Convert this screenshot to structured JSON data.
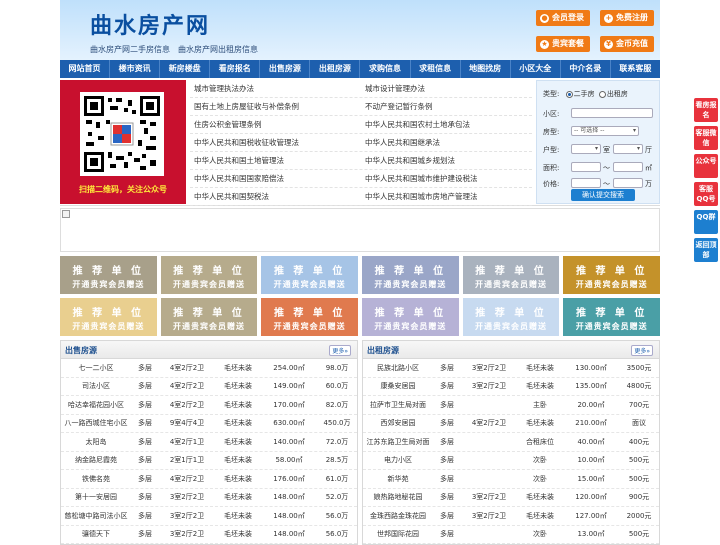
{
  "header": {
    "logo": "曲水房产网",
    "slogan": "曲水房产网二手房信息　曲水房产网出租房信息",
    "buttons": [
      {
        "label": "会员登录",
        "icon": "user-icon"
      },
      {
        "label": "免费注册",
        "icon": "user-add-icon"
      },
      {
        "label": "贵宾套餐",
        "icon": "vip-icon"
      },
      {
        "label": "金币充值",
        "icon": "coin-icon"
      }
    ]
  },
  "nav": [
    "网站首页",
    "楼市资讯",
    "新房楼盘",
    "看房报名",
    "出售房源",
    "出租房源",
    "求购信息",
    "求租信息",
    "地图找房",
    "小区大全",
    "中介名录",
    "联系客服"
  ],
  "qr": {
    "caption": "扫描二维码，关注公众号"
  },
  "laws": [
    [
      "城市管理执法办法",
      "城市设计管理办法"
    ],
    [
      "国有土地上房屋征收与补偿条例",
      "不动产登记暂行条例"
    ],
    [
      "住房公积金管理条例",
      "中华人民共和国农村土地承包法"
    ],
    [
      "中华人民共和国税收征收管理法",
      "中华人民共和国继承法"
    ],
    [
      "中华人民共和国土地管理法",
      "中华人民共和国城乡规划法"
    ],
    [
      "中华人民共和国国家赔偿法",
      "中华人民共和国城市维护建设税法"
    ],
    [
      "中华人民共和国契税法",
      "中华人民共和国城市房地产管理法"
    ]
  ],
  "search": {
    "type_label": "类型:",
    "type_options": [
      "二手房",
      "出租房"
    ],
    "community_label": "小区:",
    "house_label": "房型:",
    "house_select": "-- 可选择 --",
    "layout_label": "户型:",
    "room_unit": "室",
    "hall_unit": "厅",
    "area_label": "面积:",
    "area_unit": "㎡",
    "price_label": "价格:",
    "price_unit": "万",
    "range_sep": "～",
    "submit": "确认提交搜索"
  },
  "ads": {
    "line1": "推 荐 单 位",
    "line2": "开通贵宾会员赠送",
    "colors_row1": [
      "#a8a08a",
      "#b6ab8c",
      "#a6c4e6",
      "#9aa6c8",
      "#a9b2be",
      "#c4922a"
    ],
    "colors_row2": [
      "#e9cf8f",
      "#b6ab8c",
      "#e07a4e",
      "#b6b2d6",
      "#c7daf0",
      "#4a9fa6"
    ]
  },
  "sale": {
    "title": "出售房源",
    "more": "更多»",
    "rows": [
      [
        "七一二小区",
        "多层",
        "4室2厅2卫",
        "毛坯未装",
        "254.00㎡",
        "98.0万"
      ],
      [
        "司法小区",
        "多层",
        "4室2厅2卫",
        "毛坯未装",
        "149.00㎡",
        "60.0万"
      ],
      [
        "哈达幸福花园小区",
        "多层",
        "4室2厅2卫",
        "毛坯未装",
        "170.00㎡",
        "82.0万"
      ],
      [
        "八一路西城住宅小区",
        "多层",
        "9室4厅4卫",
        "毛坯未装",
        "630.00㎡",
        "450.0万"
      ],
      [
        "太阳岛",
        "多层",
        "4室2厅1卫",
        "毛坯未装",
        "140.00㎡",
        "72.0万"
      ],
      [
        "纳金路尼霞苑",
        "多层",
        "2室1厅1卫",
        "毛坯未装",
        "58.00㎡",
        "28.5万"
      ],
      [
        "铁佛名苑",
        "多层",
        "4室2厅2卫",
        "毛坯未装",
        "176.00㎡",
        "61.0万"
      ],
      [
        "第十一安居园",
        "多层",
        "3室2厅2卫",
        "毛坯未装",
        "148.00㎡",
        "52.0万"
      ],
      [
        "慈松塘中路司法小区",
        "多层",
        "3室2厅2卫",
        "毛坯未装",
        "148.00㎡",
        "56.0万"
      ],
      [
        "骧德天下",
        "多层",
        "3室2厅2卫",
        "毛坯未装",
        "148.00㎡",
        "56.0万"
      ]
    ]
  },
  "rent": {
    "title": "出租房源",
    "more": "更多»",
    "rows": [
      [
        "民族北路小区",
        "多层",
        "3室2厅2卫",
        "毛坯未装",
        "130.00㎡",
        "3500元"
      ],
      [
        "康桑安居园",
        "多层",
        "3室2厅2卫",
        "毛坯未装",
        "135.00㎡",
        "4800元"
      ],
      [
        "拉萨市卫生局对面",
        "多层",
        "",
        "主卧",
        "20.00㎡",
        "700元"
      ],
      [
        "西郊安居园",
        "多层",
        "4室2厅2卫",
        "毛坯未装",
        "210.00㎡",
        "面议"
      ],
      [
        "江苏东路卫生局对面",
        "多层",
        "",
        "合租床位",
        "40.00㎡",
        "400元"
      ],
      [
        "电力小区",
        "多层",
        "",
        "次卧",
        "10.00㎡",
        "500元"
      ],
      [
        "新华苑",
        "多层",
        "",
        "次卧",
        "15.00㎡",
        "500元"
      ],
      [
        "娘热路地秘花园",
        "多层",
        "3室2厅2卫",
        "毛坯未装",
        "120.00㎡",
        "900元"
      ],
      [
        "金珠西路金珠花园",
        "多层",
        "3室2厅2卫",
        "毛坯未装",
        "127.00㎡",
        "2000元"
      ],
      [
        "世邦国际花园",
        "多层",
        "",
        "次卧",
        "13.00㎡",
        "500元"
      ]
    ]
  },
  "side": [
    {
      "label": "看房报名",
      "color": "#e8323c"
    },
    {
      "label": "客服微信",
      "color": "#e8323c"
    },
    {
      "label": "公众号",
      "color": "#e8323c"
    },
    {
      "label": "客服QQ号",
      "color": "#e8323c"
    },
    {
      "label": "QQ群",
      "color": "#1d7fd0"
    },
    {
      "label": "返回顶部",
      "color": "#1d7fd0"
    }
  ]
}
